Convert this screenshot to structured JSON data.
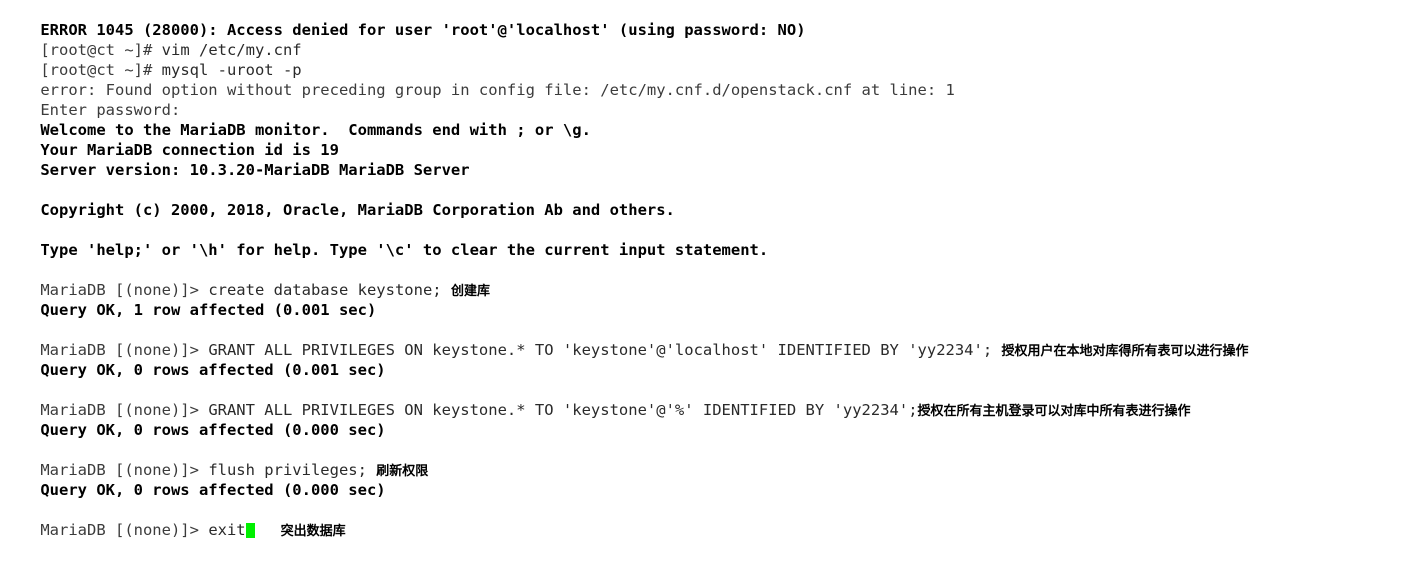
{
  "terminal": {
    "background_color": "#ffffff",
    "text_color": "#3b3b3b",
    "output_color": "#000000",
    "cursor_color": "#00f000",
    "prompt_shell": "[root@ct ~]# ",
    "prompt_db": "MariaDB [(none)]> ",
    "lines": {
      "error_access_denied": "ERROR 1045 (28000): Access denied for user 'root'@'localhost' (using password: NO)",
      "cmd_vim": "vim /etc/my.cnf",
      "cmd_mysql": "mysql -uroot -p",
      "error_found_option": "error: Found option without preceding group in config file: /etc/my.cnf.d/openstack.cnf at line: 1",
      "enter_password": "Enter password:",
      "welcome": "Welcome to the MariaDB monitor.  Commands end with ; or \\g.",
      "connection_id": "Your MariaDB connection id is 19",
      "server_version": "Server version: 10.3.20-MariaDB MariaDB Server",
      "copyright": "Copyright (c) 2000, 2018, Oracle, MariaDB Corporation Ab and others.",
      "type_help": "Type 'help;' or '\\h' for help. Type '\\c' to clear the current input statement.",
      "cmd_create_db": "create database keystone; ",
      "out_create_db": "Query OK, 1 row affected (0.001 sec)",
      "cmd_grant_localhost": "GRANT ALL PRIVILEGES ON keystone.* TO 'keystone'@'localhost' IDENTIFIED BY 'yy2234'; ",
      "out_grant_localhost": "Query OK, 0 rows affected (0.001 sec)",
      "cmd_grant_any": "GRANT ALL PRIVILEGES ON keystone.* TO 'keystone'@'%' IDENTIFIED BY 'yy2234';",
      "out_grant_any": "Query OK, 0 rows affected (0.000 sec)",
      "cmd_flush": "flush privileges; ",
      "out_flush": "Query OK, 0 rows affected (0.000 sec)",
      "cmd_exit": "exit"
    },
    "annotations": {
      "create_db": "创建库",
      "grant_localhost": "授权用户在本地对库得所有表可以进行操作",
      "grant_any": "授权在所有主机登录可以对库中所有表进行操作",
      "flush": "刷新权限",
      "exit": "突出数据库"
    }
  }
}
